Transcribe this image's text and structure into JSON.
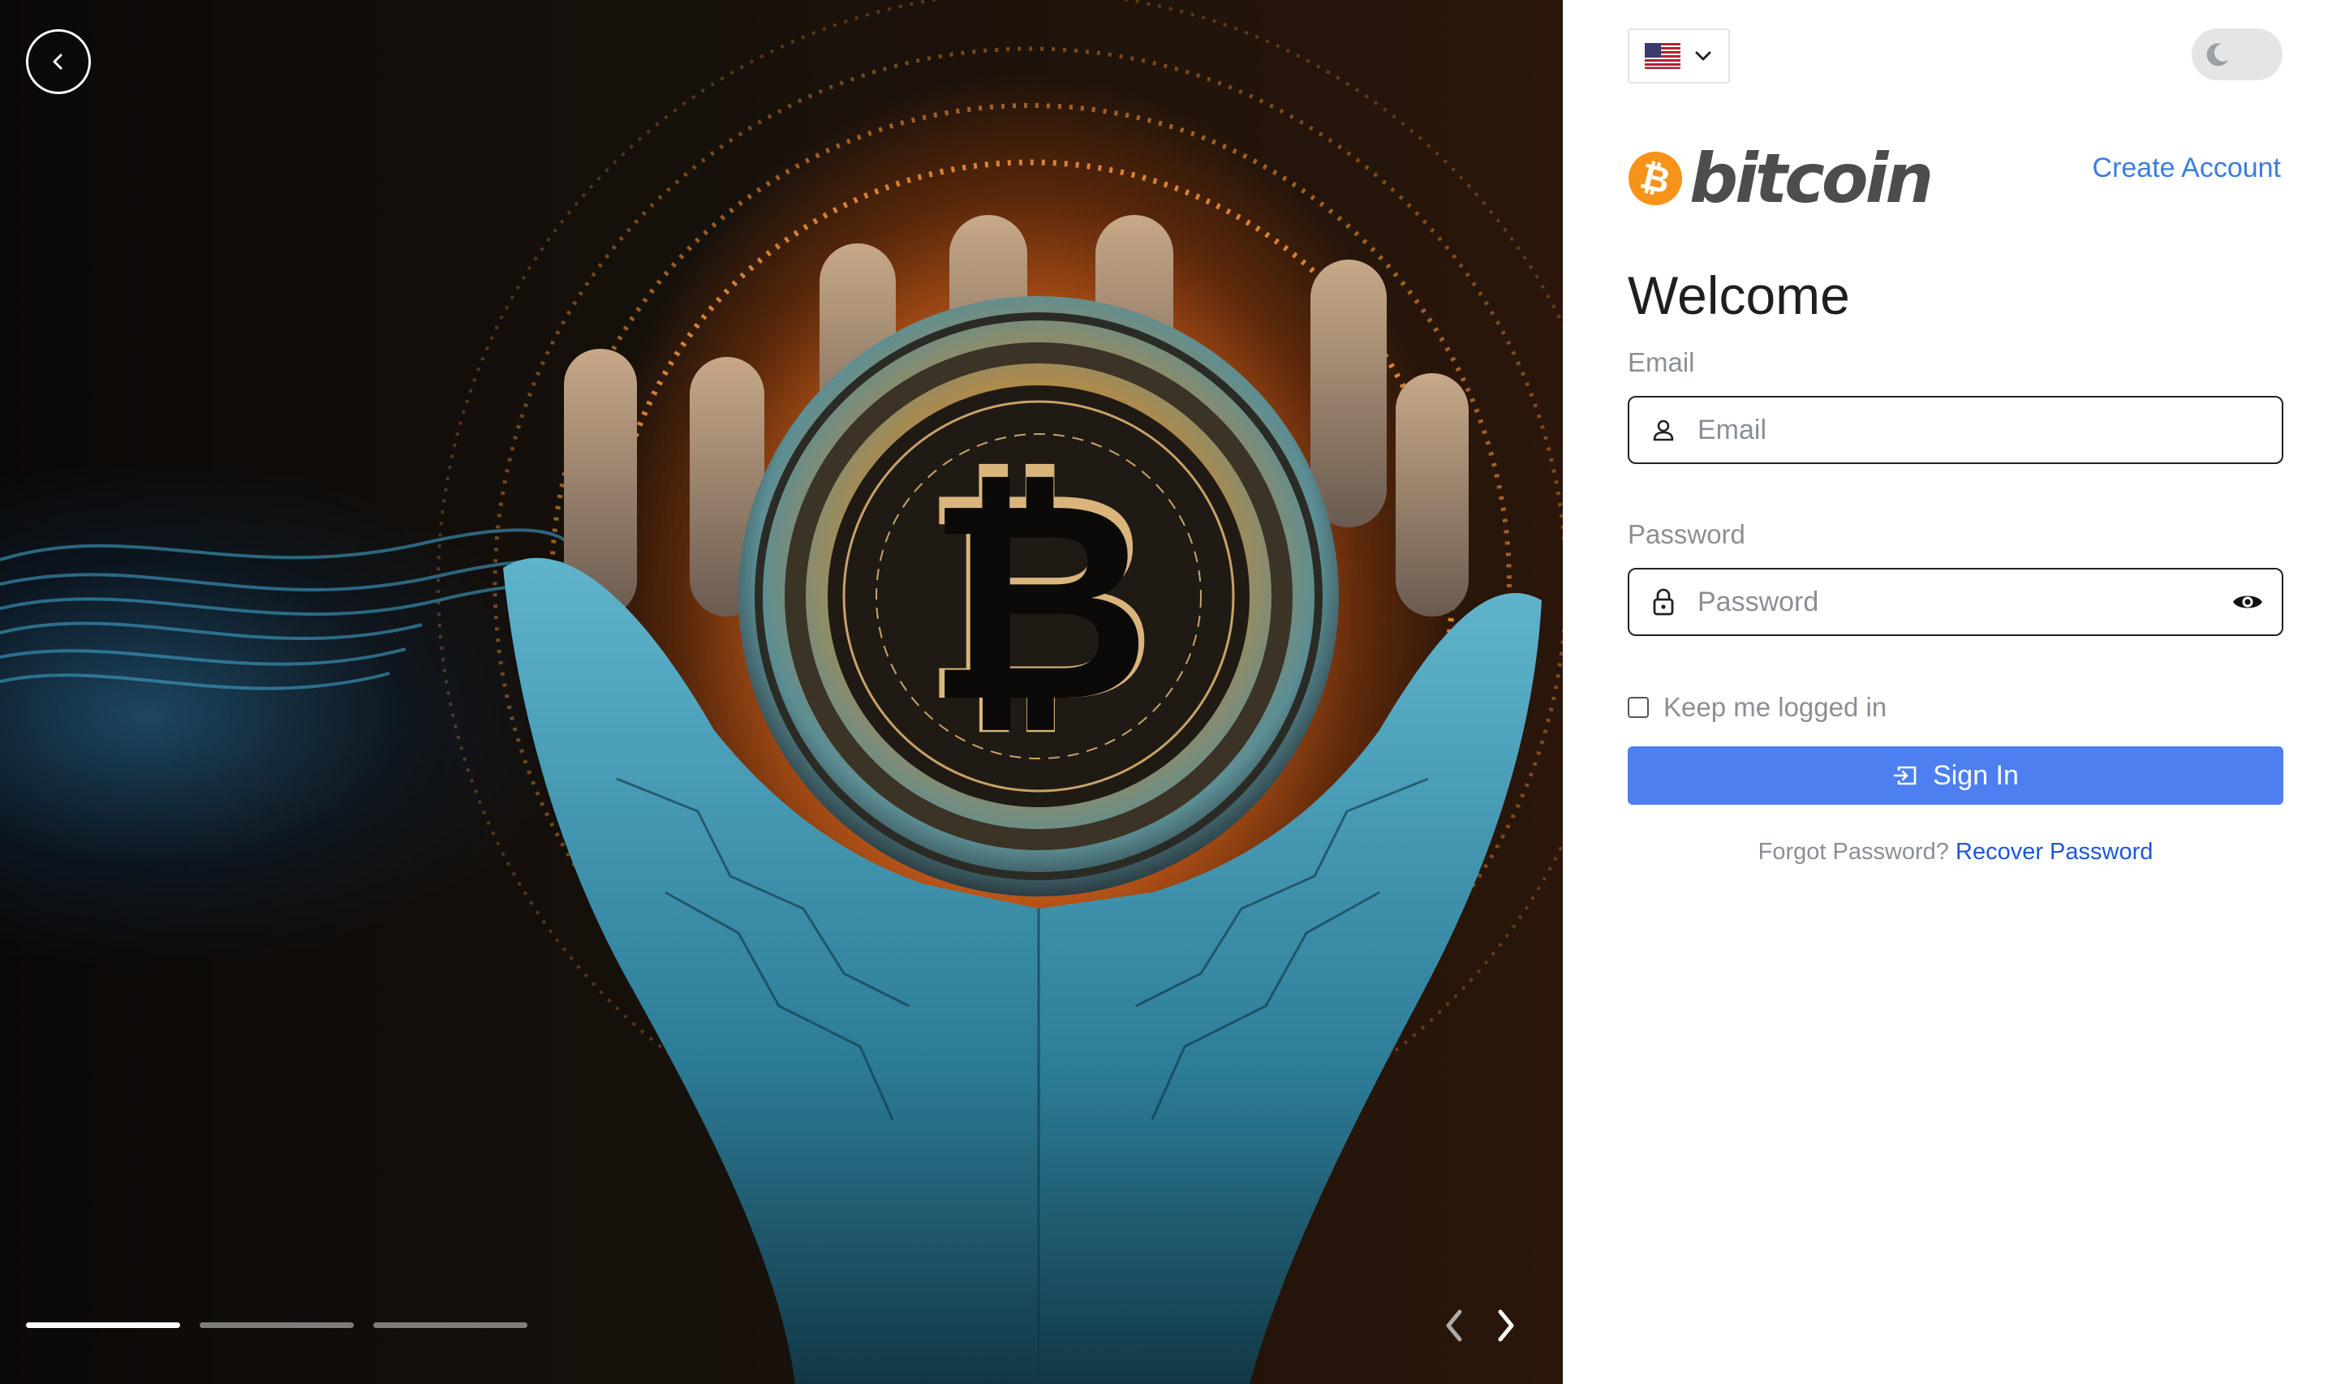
{
  "hero": {
    "image_alt": "Hands holding a golden bitcoin coin over an orange glow",
    "slides": [
      {
        "active": true
      },
      {
        "active": false
      },
      {
        "active": false
      }
    ]
  },
  "header": {
    "language": "en-US",
    "theme_mode": "light"
  },
  "logo": {
    "wordmark": "bitcoin",
    "symbol": "₿",
    "brand_color": "#F7931A"
  },
  "nav": {
    "create_account": "Create Account"
  },
  "form": {
    "title": "Welcome",
    "email_label": "Email",
    "email_placeholder": "Email",
    "email_value": "",
    "password_label": "Password",
    "password_placeholder": "Password",
    "password_value": "",
    "remember_label": "Keep me logged in",
    "remember_checked": false,
    "submit_label": "Sign In",
    "forgot_text": "Forgot Password?",
    "recover_link": "Recover Password"
  },
  "colors": {
    "primary": "#4D7FF0",
    "link": "#3B7DDD",
    "recover_link": "#1D56D9",
    "muted_text": "#8A8F96"
  }
}
